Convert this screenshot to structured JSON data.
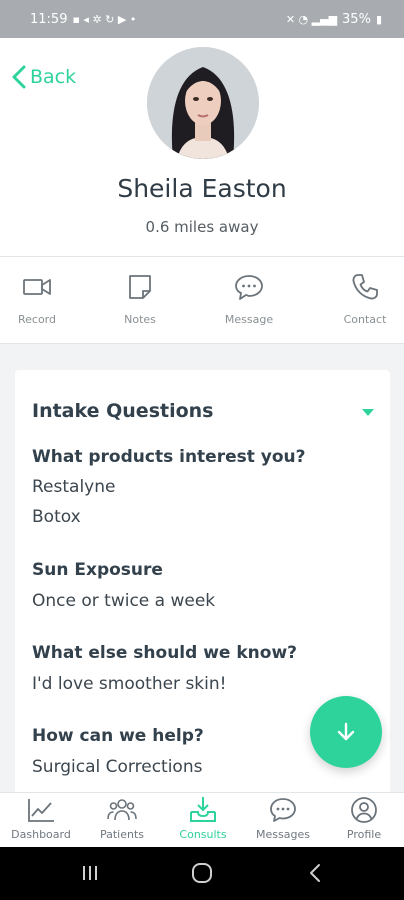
{
  "status_bar": {
    "time": "11:59",
    "battery": "35%"
  },
  "header": {
    "back_label": "Back",
    "name": "Sheila Easton",
    "distance": "0.6 miles away"
  },
  "actions": [
    {
      "label": "Record",
      "icon": "video-icon"
    },
    {
      "label": "Notes",
      "icon": "note-icon"
    },
    {
      "label": "Message",
      "icon": "chat-bubble-icon"
    },
    {
      "label": "Contact",
      "icon": "phone-icon"
    }
  ],
  "intake": {
    "title": "Intake Questions",
    "questions": [
      {
        "q": "What products interest you?",
        "answers": [
          "Restalyne",
          "Botox"
        ]
      },
      {
        "q": "Sun Exposure",
        "answers": [
          "Once or twice a week"
        ]
      },
      {
        "q": "What else should we know?",
        "answers": [
          "I'd love smoother skin!"
        ]
      },
      {
        "q": "How can we help?",
        "answers": [
          "Surgical Corrections"
        ]
      }
    ]
  },
  "bottom_nav": [
    {
      "label": "Dashboard",
      "icon": "chart-icon",
      "active": false
    },
    {
      "label": "Patients",
      "icon": "people-icon",
      "active": false
    },
    {
      "label": "Consults",
      "icon": "inbox-download-icon",
      "active": true
    },
    {
      "label": "Messages",
      "icon": "chat-icon",
      "active": false
    },
    {
      "label": "Profile",
      "icon": "user-circle-icon",
      "active": false
    }
  ],
  "colors": {
    "accent": "#2ed39b",
    "text_dark": "#33414c",
    "background": "#f2f3f4"
  }
}
